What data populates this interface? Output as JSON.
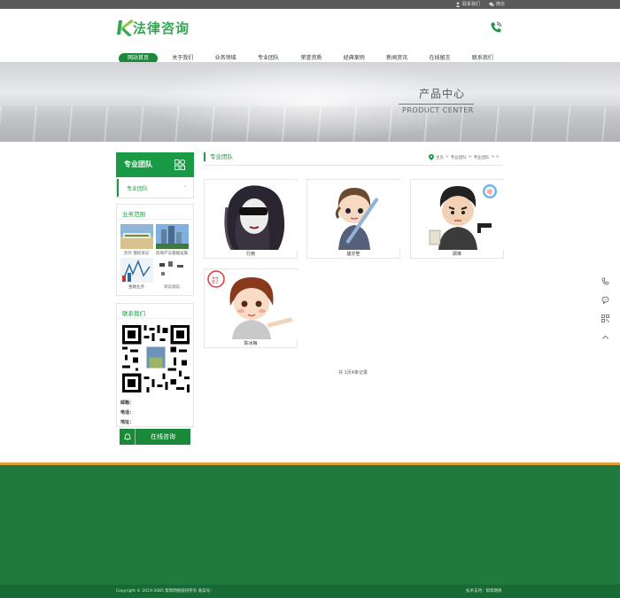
{
  "topbar": {
    "links": [
      {
        "label": "联系我们",
        "icon": "user-icon"
      },
      {
        "label": "微信",
        "icon": "wechat-icon"
      }
    ]
  },
  "header": {
    "logo_text": "法律咨询",
    "nav": [
      "网站首页",
      "关于我们",
      "业务领域",
      "专业团队",
      "荣誉资质",
      "经典案例",
      "新闻资讯",
      "在线留言",
      "联系我们"
    ],
    "active_index": 0
  },
  "banner": {
    "title_cn": "产品中心",
    "title_en": "PRODUCT CENTER"
  },
  "sidebar": {
    "heading": "专业团队",
    "sub_item": "专业团队",
    "business": {
      "title": "业务范围",
      "items": [
        "涉外 侵权诉讼",
        "房地产与基础设施",
        "金融业务",
        "诉讼诉讼"
      ]
    },
    "contact": {
      "title": "联系我们",
      "lines": [
        "邮箱：",
        "电话：",
        "地址："
      ],
      "button": "在线咨询"
    }
  },
  "main": {
    "section_title": "专业团队",
    "breadcrumb": [
      "主页",
      "专业团队",
      "专业团队"
    ],
    "products": [
      "行雨",
      "楚亦笙",
      "顾锋",
      "陈冰梅"
    ],
    "pager": "共 1页4条记录"
  },
  "footer": {
    "copyright": "Copyright © 2019-2085 帮帮网络版权所有     备案号：",
    "support": "技术支持：帮帮网络"
  },
  "colors": {
    "accent": "#1a9a45",
    "footer": "#1e7b3d",
    "footer_border": "#e0a035"
  }
}
